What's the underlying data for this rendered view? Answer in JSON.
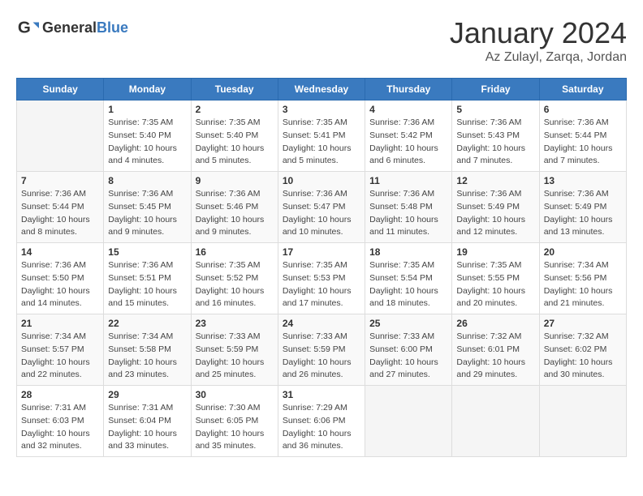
{
  "header": {
    "logo_general": "General",
    "logo_blue": "Blue",
    "month_title": "January 2024",
    "location": "Az Zulayl, Zarqa, Jordan"
  },
  "weekdays": [
    "Sunday",
    "Monday",
    "Tuesday",
    "Wednesday",
    "Thursday",
    "Friday",
    "Saturday"
  ],
  "weeks": [
    [
      {
        "day": "",
        "info": ""
      },
      {
        "day": "1",
        "info": "Sunrise: 7:35 AM\nSunset: 5:40 PM\nDaylight: 10 hours\nand 4 minutes."
      },
      {
        "day": "2",
        "info": "Sunrise: 7:35 AM\nSunset: 5:40 PM\nDaylight: 10 hours\nand 5 minutes."
      },
      {
        "day": "3",
        "info": "Sunrise: 7:35 AM\nSunset: 5:41 PM\nDaylight: 10 hours\nand 5 minutes."
      },
      {
        "day": "4",
        "info": "Sunrise: 7:36 AM\nSunset: 5:42 PM\nDaylight: 10 hours\nand 6 minutes."
      },
      {
        "day": "5",
        "info": "Sunrise: 7:36 AM\nSunset: 5:43 PM\nDaylight: 10 hours\nand 7 minutes."
      },
      {
        "day": "6",
        "info": "Sunrise: 7:36 AM\nSunset: 5:44 PM\nDaylight: 10 hours\nand 7 minutes."
      }
    ],
    [
      {
        "day": "7",
        "info": "Sunrise: 7:36 AM\nSunset: 5:44 PM\nDaylight: 10 hours\nand 8 minutes."
      },
      {
        "day": "8",
        "info": "Sunrise: 7:36 AM\nSunset: 5:45 PM\nDaylight: 10 hours\nand 9 minutes."
      },
      {
        "day": "9",
        "info": "Sunrise: 7:36 AM\nSunset: 5:46 PM\nDaylight: 10 hours\nand 9 minutes."
      },
      {
        "day": "10",
        "info": "Sunrise: 7:36 AM\nSunset: 5:47 PM\nDaylight: 10 hours\nand 10 minutes."
      },
      {
        "day": "11",
        "info": "Sunrise: 7:36 AM\nSunset: 5:48 PM\nDaylight: 10 hours\nand 11 minutes."
      },
      {
        "day": "12",
        "info": "Sunrise: 7:36 AM\nSunset: 5:49 PM\nDaylight: 10 hours\nand 12 minutes."
      },
      {
        "day": "13",
        "info": "Sunrise: 7:36 AM\nSunset: 5:49 PM\nDaylight: 10 hours\nand 13 minutes."
      }
    ],
    [
      {
        "day": "14",
        "info": "Sunrise: 7:36 AM\nSunset: 5:50 PM\nDaylight: 10 hours\nand 14 minutes."
      },
      {
        "day": "15",
        "info": "Sunrise: 7:36 AM\nSunset: 5:51 PM\nDaylight: 10 hours\nand 15 minutes."
      },
      {
        "day": "16",
        "info": "Sunrise: 7:35 AM\nSunset: 5:52 PM\nDaylight: 10 hours\nand 16 minutes."
      },
      {
        "day": "17",
        "info": "Sunrise: 7:35 AM\nSunset: 5:53 PM\nDaylight: 10 hours\nand 17 minutes."
      },
      {
        "day": "18",
        "info": "Sunrise: 7:35 AM\nSunset: 5:54 PM\nDaylight: 10 hours\nand 18 minutes."
      },
      {
        "day": "19",
        "info": "Sunrise: 7:35 AM\nSunset: 5:55 PM\nDaylight: 10 hours\nand 20 minutes."
      },
      {
        "day": "20",
        "info": "Sunrise: 7:34 AM\nSunset: 5:56 PM\nDaylight: 10 hours\nand 21 minutes."
      }
    ],
    [
      {
        "day": "21",
        "info": "Sunrise: 7:34 AM\nSunset: 5:57 PM\nDaylight: 10 hours\nand 22 minutes."
      },
      {
        "day": "22",
        "info": "Sunrise: 7:34 AM\nSunset: 5:58 PM\nDaylight: 10 hours\nand 23 minutes."
      },
      {
        "day": "23",
        "info": "Sunrise: 7:33 AM\nSunset: 5:59 PM\nDaylight: 10 hours\nand 25 minutes."
      },
      {
        "day": "24",
        "info": "Sunrise: 7:33 AM\nSunset: 5:59 PM\nDaylight: 10 hours\nand 26 minutes."
      },
      {
        "day": "25",
        "info": "Sunrise: 7:33 AM\nSunset: 6:00 PM\nDaylight: 10 hours\nand 27 minutes."
      },
      {
        "day": "26",
        "info": "Sunrise: 7:32 AM\nSunset: 6:01 PM\nDaylight: 10 hours\nand 29 minutes."
      },
      {
        "day": "27",
        "info": "Sunrise: 7:32 AM\nSunset: 6:02 PM\nDaylight: 10 hours\nand 30 minutes."
      }
    ],
    [
      {
        "day": "28",
        "info": "Sunrise: 7:31 AM\nSunset: 6:03 PM\nDaylight: 10 hours\nand 32 minutes."
      },
      {
        "day": "29",
        "info": "Sunrise: 7:31 AM\nSunset: 6:04 PM\nDaylight: 10 hours\nand 33 minutes."
      },
      {
        "day": "30",
        "info": "Sunrise: 7:30 AM\nSunset: 6:05 PM\nDaylight: 10 hours\nand 35 minutes."
      },
      {
        "day": "31",
        "info": "Sunrise: 7:29 AM\nSunset: 6:06 PM\nDaylight: 10 hours\nand 36 minutes."
      },
      {
        "day": "",
        "info": ""
      },
      {
        "day": "",
        "info": ""
      },
      {
        "day": "",
        "info": ""
      }
    ]
  ]
}
